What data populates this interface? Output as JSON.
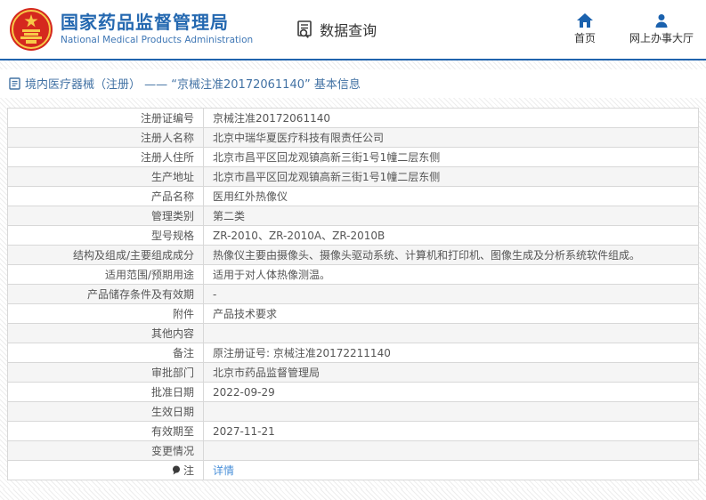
{
  "header": {
    "brand_title": "国家药品监督管理局",
    "brand_subtitle": "National Medical Products Administration",
    "query_label": "数据查询",
    "home_label": "首页",
    "hall_label": "网上办事大厅"
  },
  "breadcrumb": {
    "text": "境内医疗器械（注册） —— “京械注准20172061140” 基本信息"
  },
  "table": {
    "rows": [
      {
        "label": "注册证编号",
        "value": "京械注准20172061140"
      },
      {
        "label": "注册人名称",
        "value": "北京中瑞华夏医疗科技有限责任公司"
      },
      {
        "label": "注册人住所",
        "value": "北京市昌平区回龙观镇高新三街1号1幢二层东侧"
      },
      {
        "label": "生产地址",
        "value": "北京市昌平区回龙观镇高新三街1号1幢二层东侧"
      },
      {
        "label": "产品名称",
        "value": "医用红外热像仪"
      },
      {
        "label": "管理类别",
        "value": "第二类"
      },
      {
        "label": "型号规格",
        "value": "ZR-2010、ZR-2010A、ZR-2010B"
      },
      {
        "label": "结构及组成/主要组成成分",
        "value": "热像仪主要由摄像头、摄像头驱动系统、计算机和打印机、图像生成及分析系统软件组成。"
      },
      {
        "label": "适用范围/预期用途",
        "value": "适用于对人体热像测温。"
      },
      {
        "label": "产品储存条件及有效期",
        "value": "-"
      },
      {
        "label": "附件",
        "value": "产品技术要求"
      },
      {
        "label": "其他内容",
        "value": ""
      },
      {
        "label": "备注",
        "value": "原注册证号: 京械注准20172211140"
      },
      {
        "label": "审批部门",
        "value": "北京市药品监督管理局"
      },
      {
        "label": "批准日期",
        "value": "2022-09-29"
      },
      {
        "label": "生效日期",
        "value": ""
      },
      {
        "label": "有效期至",
        "value": "2027-11-21"
      },
      {
        "label": "变更情况",
        "value": ""
      },
      {
        "label": "注",
        "value": "详情"
      }
    ]
  },
  "colors": {
    "brand_blue": "#2468b0",
    "divider_blue": "#2063ad",
    "icon_blue": "#1b62ae",
    "crumb_blue": "#4272a4",
    "link_blue": "#4a90d9",
    "emblem_red": "#d5281e",
    "emblem_gold": "#f7c948",
    "row_alt_gray": "#f5f5f5"
  }
}
